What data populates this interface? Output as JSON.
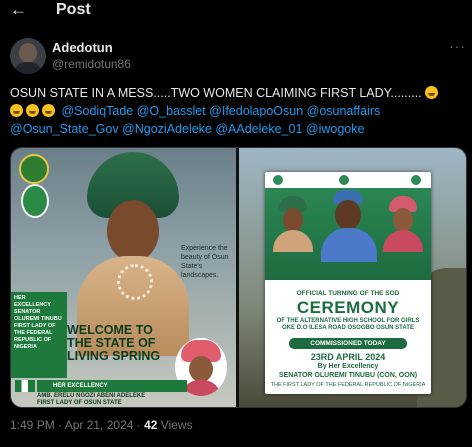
{
  "header": {
    "title": "Post"
  },
  "author": {
    "display_name": "Adedotun",
    "handle": "@remidotun86"
  },
  "tweet": {
    "line1": "OSUN STATE IN A MESS.....TWO WOMEN CLAIMING FIRST LADY.........",
    "mentions_line2": "@SodiqTade @O_basslet @IfedolapoOsun @osunaffairs",
    "mentions_line3": "@Osun_State_Gov @NgoziAdeleke @AAdeleke_01 @iwogoke"
  },
  "media_left": {
    "scenic_caption": "Experience the beauty of Osun State's landscapes.",
    "her_excellency_block": "HER EXCELLENCY SENATOR OLUREMI TINUBU FIRST LADY OF THE FEDERAL REPUBLIC OF NIGERIA",
    "welcome": "WELCOME TO THE STATE OF LIVING SPRING",
    "her_excellency_label": "HER EXCELLENCY",
    "erelu_name": "AMB. ERELU NGOZI ABENI ADELEKE",
    "erelu_title": "FIRST LADY OF OSUN STATE"
  },
  "media_right": {
    "official": "OFFICIAL TURNING OF THE SOD",
    "ceremony": "CEREMONY",
    "school_line1": "OF THE ALTERNATIVE HIGH SCHOOL FOR GIRLS",
    "school_line2": "OKE D.O ILESA ROAD OSOGBO OSUN STATE",
    "commissioned": "COMMISSIONED TODAY",
    "date": "23RD APRIL 2024",
    "by": "By Her Excellency",
    "senator": "SENATOR OLUREMI TINUBU (CON, OON)",
    "first_lady": "THE FIRST LADY OF THE FEDERAL REPUBLIC OF NIGERIA"
  },
  "meta": {
    "time": "1:49 PM · Apr 21, 2024 · ",
    "views_count": "42",
    "views_label": " Views"
  }
}
